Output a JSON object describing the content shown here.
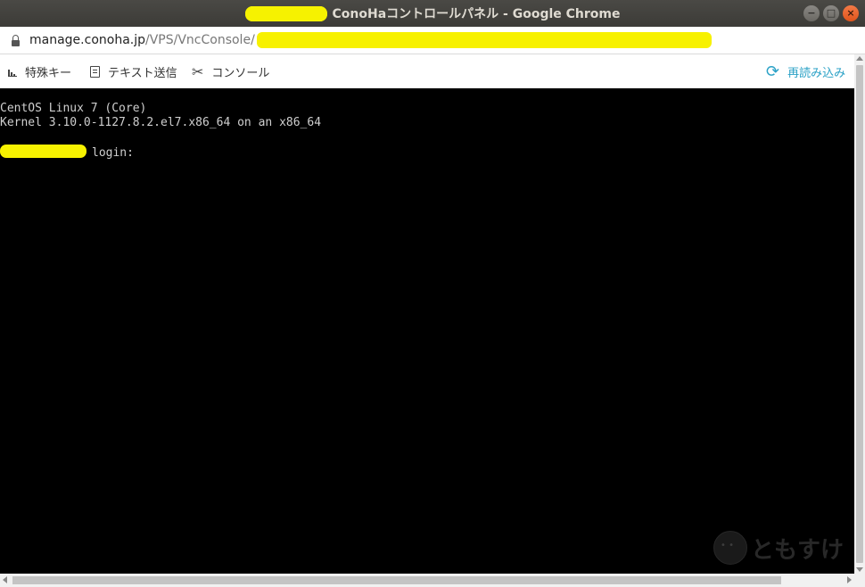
{
  "window": {
    "title": "ConoHaコントロールパネル - Google Chrome",
    "buttons": {
      "minimize": "−",
      "maximize": "□",
      "close": "×"
    }
  },
  "addressbar": {
    "domain": "manage.conoha.jp",
    "path": "/VPS/VncConsole/"
  },
  "toolbar": {
    "special_keys": "特殊キー",
    "send_text": "テキスト送信",
    "console": "コンソール",
    "reload": "再読み込み"
  },
  "console": {
    "line1": "CentOS Linux 7 (Core)",
    "line2": "Kernel 3.10.0-1127.8.2.el7.x86_64 on an x86_64",
    "login_prompt": "login:"
  },
  "watermark": {
    "text": "ともすけ"
  },
  "icons": {
    "lock": "lock-icon",
    "special_keys": "bars-icon",
    "send_text": "document-icon",
    "console": "tools-icon",
    "reload": "refresh-icon"
  },
  "colors": {
    "accent": "#2aa1c6",
    "redaction": "#f7f200",
    "console_bg": "#000000",
    "console_fg": "#cfcfcf"
  }
}
